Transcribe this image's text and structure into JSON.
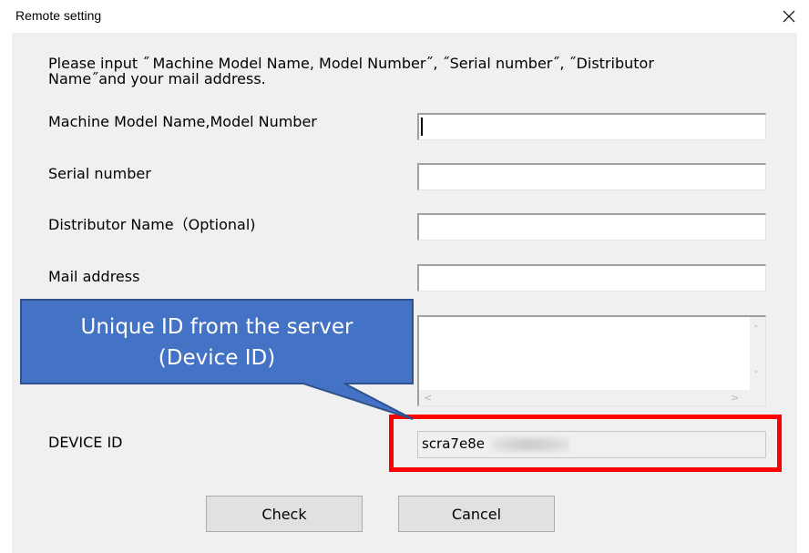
{
  "window": {
    "title": "Remote setting",
    "close_symbol": "✕"
  },
  "instructions": "Please input ˝ Machine Model Name, Model Number˝, ˝Serial number˝, ˝Distributor\nName˝and your mail address.",
  "fields": {
    "model": {
      "label": "Machine Model Name,Model Number",
      "value": ""
    },
    "serial": {
      "label": "Serial number",
      "value": ""
    },
    "distributor": {
      "label": "Distributor Name（Optional)",
      "value": ""
    },
    "mail": {
      "label": "Mail address",
      "value": ""
    },
    "device_id": {
      "label": "DEVICE ID",
      "value": "scra7e8e"
    }
  },
  "scroll_arrows": {
    "up": "˄",
    "down": "˅",
    "left": "<",
    "right": ">"
  },
  "buttons": {
    "check": "Check",
    "cancel": "Cancel"
  },
  "callout": {
    "line1": "Unique ID from the server",
    "line2": "(Device ID)",
    "fill_color": "#4472c4",
    "border_color": "#2f528f"
  },
  "highlight_color": "#ff0000",
  "icons": {
    "close": "close-icon",
    "scroll_up": "chevron-up-icon",
    "scroll_down": "chevron-down-icon",
    "scroll_left": "chevron-left-icon",
    "scroll_right": "chevron-right-icon"
  }
}
